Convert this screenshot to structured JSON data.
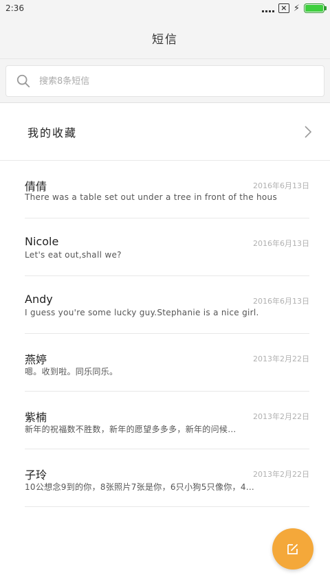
{
  "status_bar": {
    "time": "2:36"
  },
  "header": {
    "title": "短信"
  },
  "search": {
    "placeholder": "搜索8条短信"
  },
  "favorites": {
    "label": "我的收藏"
  },
  "messages": [
    {
      "name": "倩倩",
      "date": "2016年6月13日",
      "preview": "There was a table set out under a tree in front of the hous"
    },
    {
      "name": "Nicole",
      "date": "2016年6月13日",
      "preview": "Let's eat out,shall we?"
    },
    {
      "name": "Andy",
      "date": "2016年6月13日",
      "preview": "I guess you're some lucky guy.Stephanie is a nice girl."
    },
    {
      "name": "燕婷",
      "date": "2013年2月22日",
      "preview": "嗯。收到啦。同乐同乐。"
    },
    {
      "name": "紫楠",
      "date": "2013年2月22日",
      "preview": "新年的祝福数不胜数，新年的愿望多多多，新年的问候…"
    },
    {
      "name": "子玲",
      "date": "2013年2月22日",
      "preview": "10公想念9到的你，8张照片7张是你，6只小狗5只像你，4…"
    }
  ],
  "icons": {
    "search": "search-icon",
    "chevron": "chevron-right-icon",
    "compose": "compose-icon"
  },
  "colors": {
    "fab": "#f4a83a",
    "battery": "#3ecf3e"
  }
}
